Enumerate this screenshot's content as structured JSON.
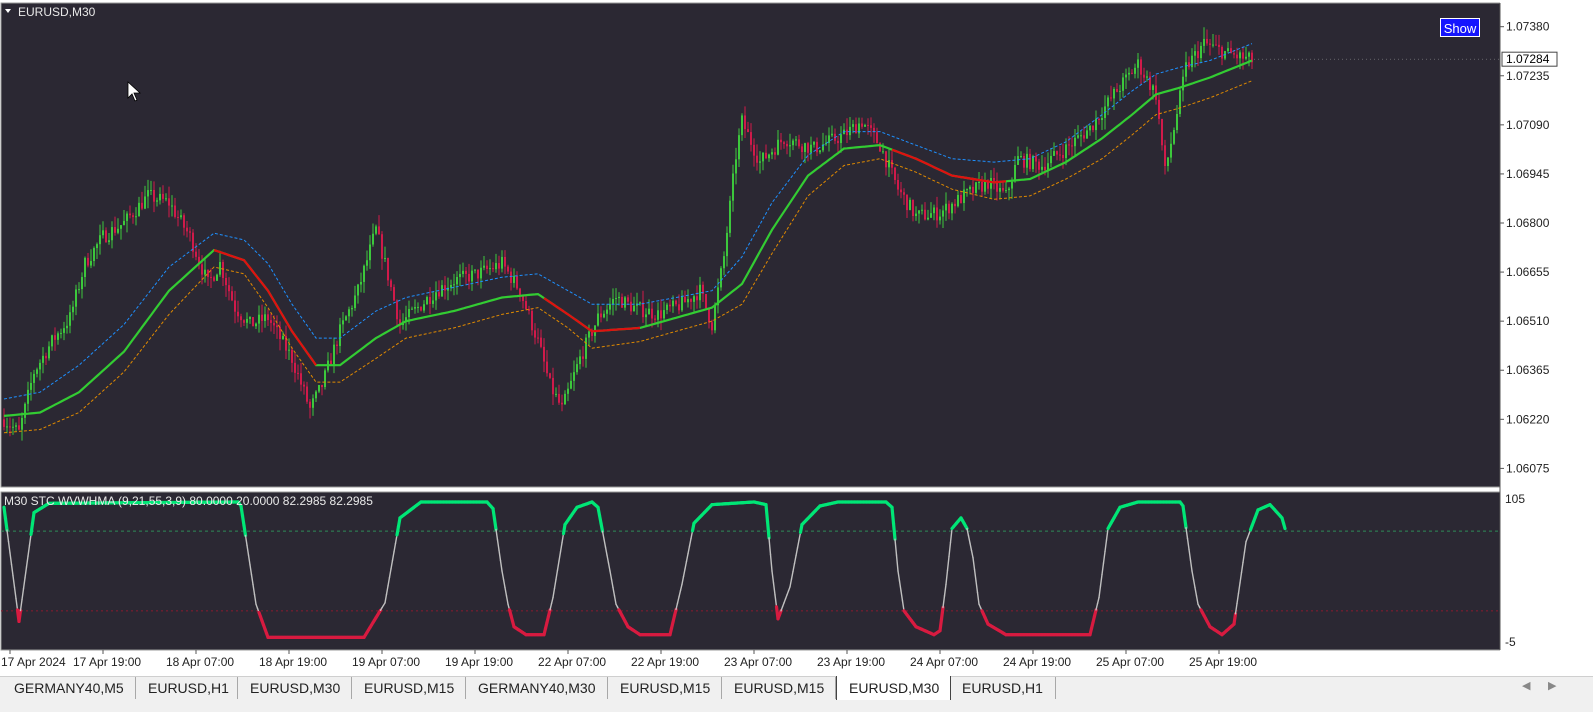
{
  "window": {
    "title": "EURUSD,M30"
  },
  "show_button": {
    "label": "Show"
  },
  "current_price": "1.07284",
  "indicator": {
    "label": "M30 STC WVWHMA  (9,21,55,3,9) 80.0000 20.0000 82.2985 82.2985"
  },
  "tabs": [
    {
      "label": "GERMANY40,M5",
      "active": false
    },
    {
      "label": "EURUSD,H1",
      "active": false
    },
    {
      "label": "EURUSD,M30",
      "active": false
    },
    {
      "label": "EURUSD,M15",
      "active": false
    },
    {
      "label": "GERMANY40,M30",
      "active": false
    },
    {
      "label": "EURUSD,M15",
      "active": false
    },
    {
      "label": "EURUSD,M15",
      "active": false
    },
    {
      "label": "EURUSD,M30",
      "active": true
    },
    {
      "label": "EURUSD,H1",
      "active": false
    }
  ],
  "colors": {
    "background": "#2b2833",
    "bull": "#3cc83c",
    "bear": "#d01a4a",
    "ma_up": "#33cc33",
    "ma_down": "#e01010",
    "band_upper": "#1e90ff",
    "band_lower": "#e08a00",
    "stc_mid": "#c0c0c0",
    "stc_high": "#00e676",
    "stc_low": "#d81b40"
  },
  "chart_data": [
    {
      "type": "candlestick",
      "symbol": "EURUSD",
      "timeframe": "M30",
      "x_tick_labels": [
        "17 Apr 2024",
        "17 Apr 19:00",
        "18 Apr 07:00",
        "18 Apr 19:00",
        "19 Apr 07:00",
        "19 Apr 19:00",
        "22 Apr 07:00",
        "22 Apr 19:00",
        "23 Apr 07:00",
        "23 Apr 19:00",
        "24 Apr 07:00",
        "24 Apr 19:00",
        "25 Apr 07:00",
        "25 Apr 19:00"
      ],
      "y_tick_labels": [
        "1.07380",
        "1.07235",
        "1.07090",
        "1.06945",
        "1.06800",
        "1.06655",
        "1.06510",
        "1.06365",
        "1.06220",
        "1.06075"
      ],
      "ylim": [
        1.0602,
        1.0745
      ],
      "close_path": [
        [
          0,
          1.0622
        ],
        [
          5,
          1.0618
        ],
        [
          10,
          1.0636
        ],
        [
          16,
          1.0645
        ],
        [
          22,
          1.0652
        ],
        [
          27,
          1.0668
        ],
        [
          33,
          1.0676
        ],
        [
          40,
          1.068
        ],
        [
          48,
          1.0688
        ],
        [
          55,
          1.0686
        ],
        [
          62,
          1.0676
        ],
        [
          68,
          1.0662
        ],
        [
          72,
          1.0668
        ],
        [
          77,
          1.0655
        ],
        [
          82,
          1.065
        ],
        [
          88,
          1.0652
        ],
        [
          96,
          1.064
        ],
        [
          102,
          1.0625
        ],
        [
          106,
          1.0632
        ],
        [
          112,
          1.0648
        ],
        [
          118,
          1.066
        ],
        [
          124,
          1.0678
        ],
        [
          127,
          1.0668
        ],
        [
          132,
          1.065
        ],
        [
          138,
          1.0655
        ],
        [
          144,
          1.066
        ],
        [
          150,
          1.0663
        ],
        [
          158,
          1.0665
        ],
        [
          166,
          1.0668
        ],
        [
          172,
          1.066
        ],
        [
          178,
          1.0645
        ],
        [
          182,
          1.0632
        ],
        [
          186,
          1.0625
        ],
        [
          192,
          1.064
        ],
        [
          198,
          1.0652
        ],
        [
          204,
          1.0658
        ],
        [
          210,
          1.0655
        ],
        [
          218,
          1.0653
        ],
        [
          226,
          1.0656
        ],
        [
          232,
          1.066
        ],
        [
          236,
          1.065
        ],
        [
          240,
          1.067
        ],
        [
          244,
          1.07
        ],
        [
          246,
          1.071
        ],
        [
          252,
          1.0698
        ],
        [
          260,
          1.0705
        ],
        [
          270,
          1.0702
        ],
        [
          280,
          1.0706
        ],
        [
          286,
          1.071
        ],
        [
          292,
          1.0703
        ],
        [
          298,
          1.069
        ],
        [
          304,
          1.0682
        ],
        [
          312,
          1.0683
        ],
        [
          320,
          1.0688
        ],
        [
          328,
          1.0692
        ],
        [
          334,
          1.0688
        ],
        [
          338,
          1.0699
        ],
        [
          346,
          1.0697
        ],
        [
          354,
          1.0702
        ],
        [
          362,
          1.0708
        ],
        [
          370,
          1.0718
        ],
        [
          378,
          1.0727
        ],
        [
          384,
          1.0718
        ],
        [
          387,
          1.0695
        ],
        [
          390,
          1.0708
        ],
        [
          394,
          1.0726
        ],
        [
          400,
          1.0733
        ],
        [
          408,
          1.073
        ],
        [
          416,
          1.0728
        ]
      ],
      "series": [
        {
          "name": "WVWHMA",
          "values": [
            [
              0,
              1.0623
            ],
            [
              12,
              1.0624
            ],
            [
              25,
              1.063
            ],
            [
              40,
              1.0642
            ],
            [
              55,
              1.066
            ],
            [
              70,
              1.0672
            ],
            [
              80,
              1.0669
            ],
            [
              88,
              1.066
            ],
            [
              96,
              1.0648
            ],
            [
              104,
              1.0638
            ],
            [
              112,
              1.0638
            ],
            [
              124,
              1.0646
            ],
            [
              134,
              1.0651
            ],
            [
              150,
              1.0654
            ],
            [
              166,
              1.0658
            ],
            [
              178,
              1.0659
            ],
            [
              188,
              1.0653
            ],
            [
              196,
              1.0648
            ],
            [
              212,
              1.0649
            ],
            [
              224,
              1.0652
            ],
            [
              236,
              1.0655
            ],
            [
              246,
              1.0662
            ],
            [
              256,
              1.0678
            ],
            [
              268,
              1.0694
            ],
            [
              280,
              1.0702
            ],
            [
              292,
              1.0703
            ],
            [
              304,
              1.0699
            ],
            [
              316,
              1.0694
            ],
            [
              330,
              1.0692
            ],
            [
              342,
              1.0693
            ],
            [
              354,
              1.0698
            ],
            [
              366,
              1.0705
            ],
            [
              376,
              1.0712
            ],
            [
              384,
              1.0718
            ],
            [
              392,
              1.072
            ],
            [
              402,
              1.0723
            ],
            [
              416,
              1.0728
            ]
          ]
        },
        {
          "name": "upper band",
          "values": [
            [
              0,
              1.0628
            ],
            [
              12,
              1.063
            ],
            [
              25,
              1.0638
            ],
            [
              40,
              1.065
            ],
            [
              55,
              1.0667
            ],
            [
              70,
              1.0677
            ],
            [
              80,
              1.0675
            ],
            [
              88,
              1.0668
            ],
            [
              96,
              1.0656
            ],
            [
              104,
              1.0646
            ],
            [
              112,
              1.0646
            ],
            [
              124,
              1.0654
            ],
            [
              134,
              1.0658
            ],
            [
              150,
              1.0661
            ],
            [
              166,
              1.0664
            ],
            [
              178,
              1.0665
            ],
            [
              188,
              1.066
            ],
            [
              196,
              1.0656
            ],
            [
              212,
              1.0656
            ],
            [
              224,
              1.0658
            ],
            [
              236,
              1.066
            ],
            [
              246,
              1.067
            ],
            [
              256,
              1.0686
            ],
            [
              268,
              1.07
            ],
            [
              280,
              1.0707
            ],
            [
              292,
              1.0707
            ],
            [
              304,
              1.0703
            ],
            [
              316,
              1.0699
            ],
            [
              330,
              1.0698
            ],
            [
              342,
              1.0699
            ],
            [
              354,
              1.0704
            ],
            [
              366,
              1.0712
            ],
            [
              376,
              1.0719
            ],
            [
              384,
              1.0724
            ],
            [
              392,
              1.0726
            ],
            [
              402,
              1.0728
            ],
            [
              416,
              1.0733
            ]
          ]
        },
        {
          "name": "lower band",
          "values": [
            [
              0,
              1.0618
            ],
            [
              12,
              1.0619
            ],
            [
              25,
              1.0624
            ],
            [
              40,
              1.0636
            ],
            [
              55,
              1.0653
            ],
            [
              70,
              1.0667
            ],
            [
              80,
              1.0665
            ],
            [
              88,
              1.0655
            ],
            [
              96,
              1.0643
            ],
            [
              104,
              1.0633
            ],
            [
              112,
              1.0633
            ],
            [
              124,
              1.064
            ],
            [
              134,
              1.0646
            ],
            [
              150,
              1.0649
            ],
            [
              166,
              1.0653
            ],
            [
              178,
              1.0655
            ],
            [
              188,
              1.0649
            ],
            [
              196,
              1.0643
            ],
            [
              212,
              1.0645
            ],
            [
              224,
              1.0648
            ],
            [
              236,
              1.0651
            ],
            [
              246,
              1.0656
            ],
            [
              256,
              1.0671
            ],
            [
              268,
              1.0688
            ],
            [
              280,
              1.0697
            ],
            [
              292,
              1.0699
            ],
            [
              304,
              1.0695
            ],
            [
              316,
              1.069
            ],
            [
              330,
              1.0687
            ],
            [
              342,
              1.0688
            ],
            [
              354,
              1.0693
            ],
            [
              366,
              1.0699
            ],
            [
              376,
              1.0706
            ],
            [
              384,
              1.0712
            ],
            [
              392,
              1.0714
            ],
            [
              402,
              1.0717
            ],
            [
              416,
              1.0722
            ]
          ]
        }
      ],
      "ma_down_segments": [
        [
          70,
          104
        ],
        [
          180,
          212
        ],
        [
          296,
          334
        ]
      ]
    },
    {
      "type": "line",
      "name": "STC WVWHMA",
      "ylim": [
        -5,
        105
      ],
      "y_tick_labels": [
        "105",
        "-5"
      ],
      "levels": [
        80,
        20
      ],
      "values": [
        [
          0,
          98
        ],
        [
          5,
          12
        ],
        [
          10,
          94
        ],
        [
          15,
          101
        ],
        [
          78,
          102
        ],
        [
          79,
          99
        ],
        [
          84,
          25
        ],
        [
          88,
          0
        ],
        [
          120,
          0
        ],
        [
          127,
          26
        ],
        [
          132,
          90
        ],
        [
          139,
          102
        ],
        [
          161,
          102
        ],
        [
          163,
          97
        ],
        [
          166,
          50
        ],
        [
          168,
          25
        ],
        [
          170,
          8
        ],
        [
          174,
          2
        ],
        [
          180,
          2
        ],
        [
          183,
          30
        ],
        [
          187,
          85
        ],
        [
          191,
          98
        ],
        [
          196,
          102
        ],
        [
          198,
          98
        ],
        [
          202,
          50
        ],
        [
          204,
          25
        ],
        [
          208,
          8
        ],
        [
          212,
          2
        ],
        [
          222,
          2
        ],
        [
          226,
          40
        ],
        [
          230,
          86
        ],
        [
          236,
          100
        ],
        [
          250,
          102
        ],
        [
          254,
          100
        ],
        [
          256,
          50
        ],
        [
          258,
          14
        ],
        [
          262,
          38
        ],
        [
          266,
          85
        ],
        [
          272,
          99
        ],
        [
          278,
          102
        ],
        [
          294,
          102
        ],
        [
          296,
          98
        ],
        [
          298,
          50
        ],
        [
          300,
          20
        ],
        [
          304,
          8
        ],
        [
          310,
          2
        ],
        [
          312,
          5
        ],
        [
          314,
          40
        ],
        [
          316,
          82
        ],
        [
          319,
          90
        ],
        [
          321,
          82
        ],
        [
          323,
          60
        ],
        [
          325,
          25
        ],
        [
          328,
          10
        ],
        [
          334,
          2
        ],
        [
          362,
          2
        ],
        [
          365,
          30
        ],
        [
          368,
          82
        ],
        [
          372,
          98
        ],
        [
          378,
          102
        ],
        [
          392,
          102
        ],
        [
          393,
          99
        ],
        [
          396,
          50
        ],
        [
          398,
          25
        ],
        [
          402,
          8
        ],
        [
          406,
          2
        ],
        [
          410,
          10
        ],
        [
          414,
          72
        ],
        [
          418,
          96
        ],
        [
          422,
          100
        ],
        [
          426,
          90
        ],
        [
          427,
          82
        ]
      ]
    }
  ]
}
